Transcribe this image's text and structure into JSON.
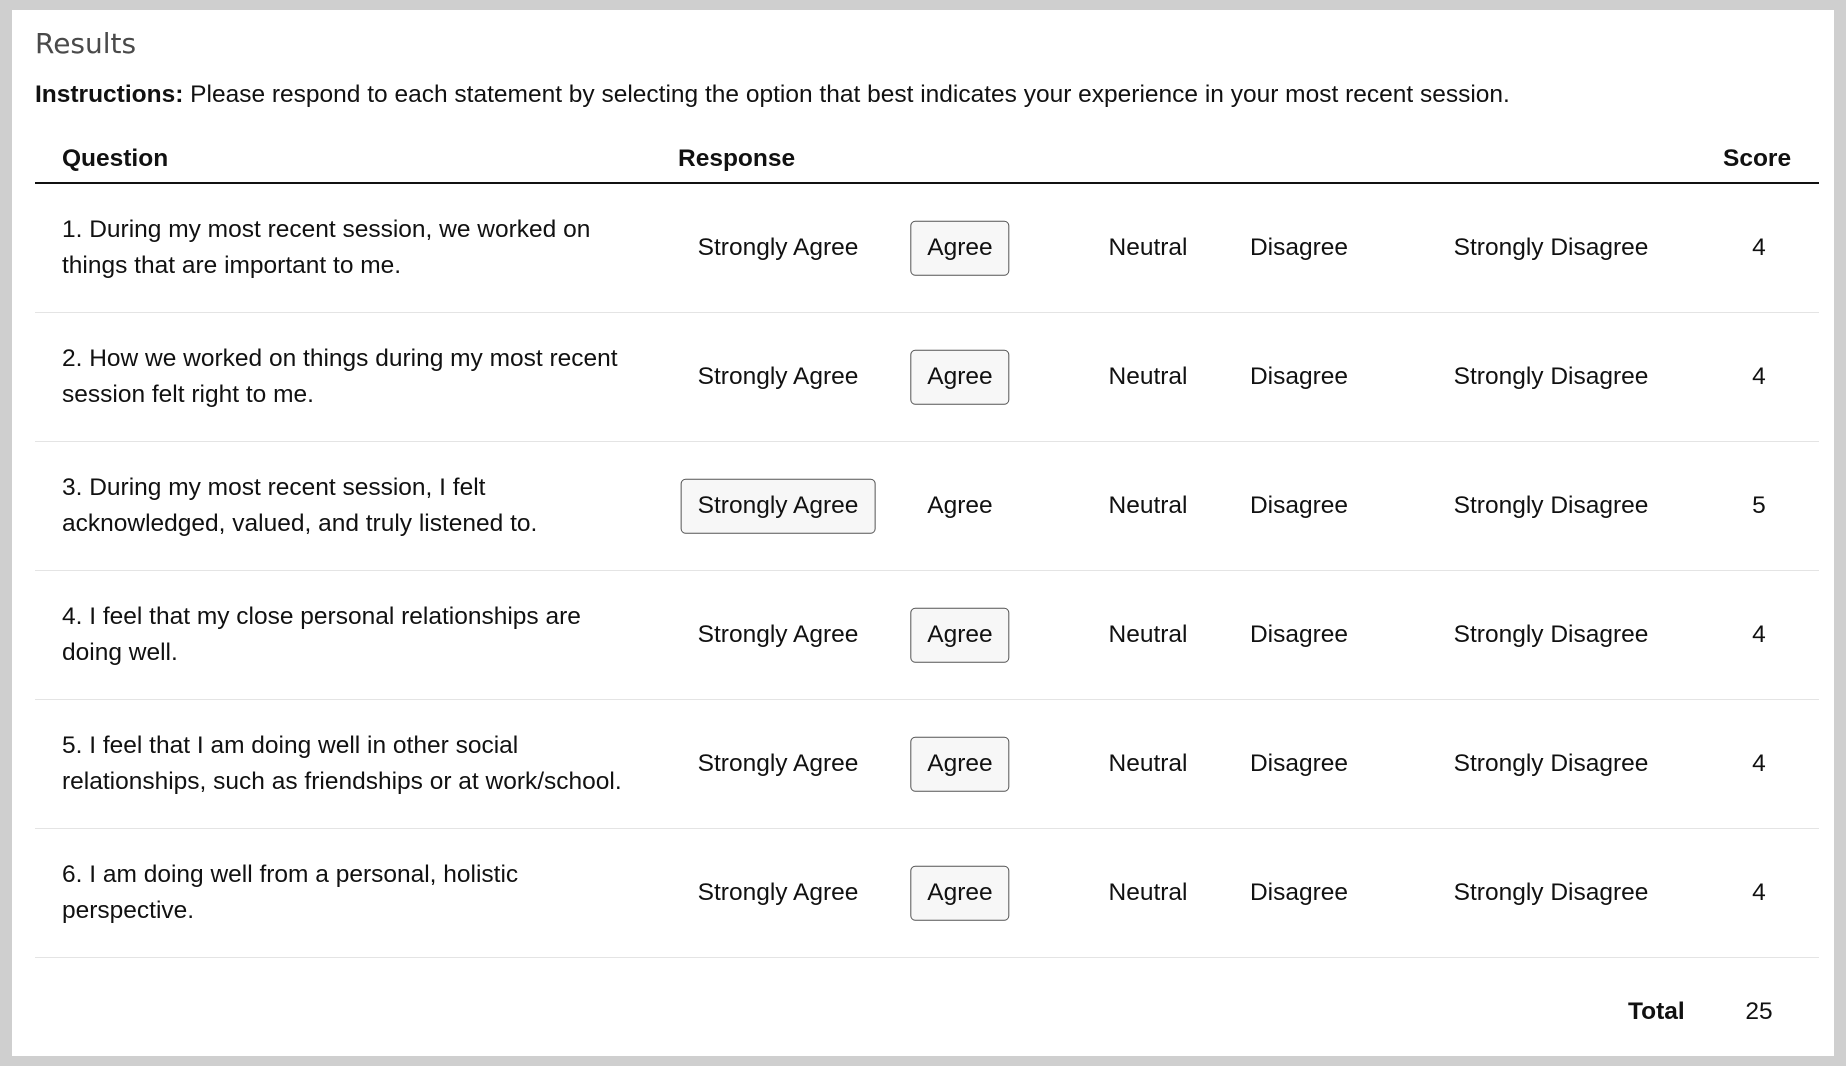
{
  "title": "Results",
  "instructions": {
    "label": "Instructions:",
    "text": " Please respond to each statement by selecting the option that best indicates your experience in your most recent session."
  },
  "table": {
    "headers": {
      "question": "Question",
      "response": "Response",
      "score": "Score"
    },
    "options": [
      "Strongly Agree",
      "Agree",
      "Neutral",
      "Disagree",
      "Strongly Disagree"
    ],
    "rows": [
      {
        "question": "1. During my most recent session, we worked on things that are important to me.",
        "selected": "Agree",
        "score": "4"
      },
      {
        "question": "2. How we worked on things during my most recent session felt right to me.",
        "selected": "Agree",
        "score": "4"
      },
      {
        "question": "3. During my most recent session, I felt acknowledged, valued, and truly listened to.",
        "selected": "Strongly Agree",
        "score": "5"
      },
      {
        "question": "4. I feel that my close personal relationships are doing well.",
        "selected": "Agree",
        "score": "4"
      },
      {
        "question": "5. I feel that I am doing well in other social relationships, such as friendships or at work/school.",
        "selected": "Agree",
        "score": "4"
      },
      {
        "question": "6. I am doing well from a personal, holistic perspective.",
        "selected": "Agree",
        "score": "4"
      }
    ],
    "total_label": "Total",
    "total_value": "25"
  }
}
